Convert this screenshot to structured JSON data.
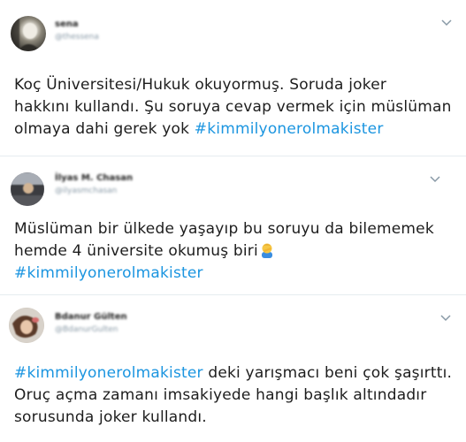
{
  "tweets": [
    {
      "author_name": "sena",
      "author_handle": "@thessena",
      "line1": "Koç Üniversitesi/Hukuk okuyormuş. Soruda joker",
      "line2": "hakkını kullandı. Şu soruya cevap vermek için müslüman",
      "line3_plain": "olmaya dahi gerek yok ",
      "hashtag": "#kimmilyonerolmakister",
      "avatar_icon": "profile-photo"
    },
    {
      "author_name": "İlyas M. Chasan",
      "author_handle": "@ilyasmchasan",
      "line1": "Müslüman bir ülkede yaşayıp bu soruyu da bilememek",
      "line2_plain": "hemde 4 üniversite okumuş biri",
      "emoji": "man-facepalming-emoji",
      "hashtag": "#kimmilyonerolmakister",
      "avatar_icon": "profile-photo"
    },
    {
      "author_name": "Bdanur Gülten",
      "author_handle": "@BdanurGulten",
      "hashtag": "#kimmilyonerolmakister",
      "line1_rest": " deki yarışmacı beni çok şaşırttı.",
      "line2": "Oruç açma zamanı imsakiyede hangi başlık altındadır",
      "line3": "sorusunda joker kullandı.",
      "avatar_icon": "profile-photo"
    }
  ],
  "colors": {
    "hashtag": "#1b95e0",
    "handle": "#8899a6",
    "divider": "#e6ecf0"
  }
}
